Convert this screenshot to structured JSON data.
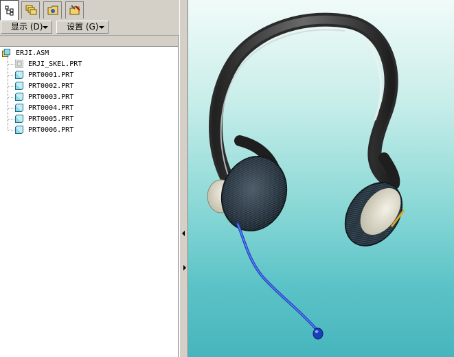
{
  "toolbar_tabs": [
    {
      "icon": "model-tree-icon",
      "active": true
    },
    {
      "icon": "layers-icon",
      "active": false
    },
    {
      "icon": "folder-browser-icon",
      "active": false
    },
    {
      "icon": "favorites-icon",
      "active": false
    }
  ],
  "menu": {
    "show_label": "显示 (D)",
    "settings_label": "设置 (G)"
  },
  "tree": {
    "root": "ERJI.ASM",
    "items": [
      {
        "label": "ERJI_SKEL.PRT",
        "type": "skeleton"
      },
      {
        "label": "PRT0001.PRT",
        "type": "part"
      },
      {
        "label": "PRT0002.PRT",
        "type": "part"
      },
      {
        "label": "PRT0003.PRT",
        "type": "part"
      },
      {
        "label": "PRT0004.PRT",
        "type": "part"
      },
      {
        "label": "PRT0005.PRT",
        "type": "part"
      },
      {
        "label": "PRT0006.PRT",
        "type": "part"
      }
    ]
  },
  "colors": {
    "panel_bg": "#d4d0c8",
    "viewport_top": "#f1fbf9",
    "viewport_bottom": "#47b5bd",
    "headband": "#3a3a3a",
    "cushion": "#2c3a48",
    "boom_wire": "#1f45c8"
  }
}
